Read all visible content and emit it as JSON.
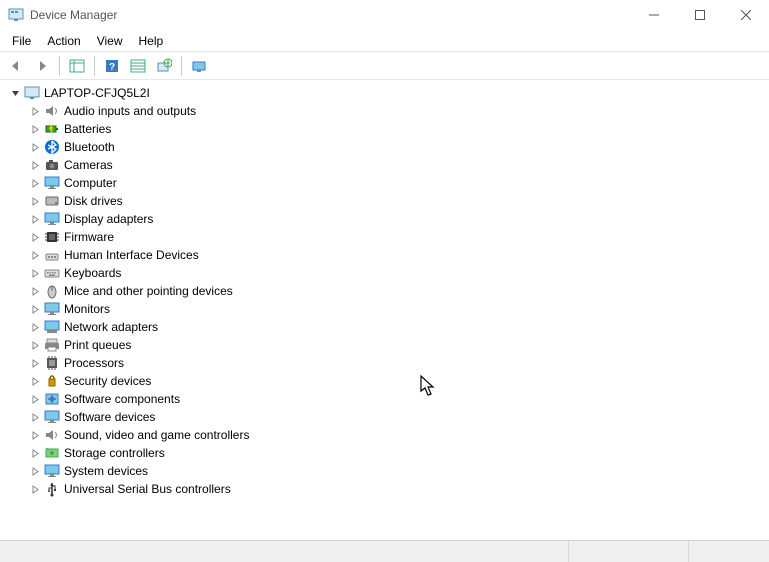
{
  "window": {
    "title": "Device Manager"
  },
  "menu": {
    "file": "File",
    "action": "Action",
    "view": "View",
    "help": "Help"
  },
  "tree": {
    "root": {
      "label": "LAPTOP-CFJQ5L2I",
      "expanded": true
    },
    "categories": [
      {
        "label": "Audio inputs and outputs",
        "icon": "speaker"
      },
      {
        "label": "Batteries",
        "icon": "battery"
      },
      {
        "label": "Bluetooth",
        "icon": "bluetooth"
      },
      {
        "label": "Cameras",
        "icon": "camera"
      },
      {
        "label": "Computer",
        "icon": "monitor"
      },
      {
        "label": "Disk drives",
        "icon": "disk"
      },
      {
        "label": "Display adapters",
        "icon": "monitor"
      },
      {
        "label": "Firmware",
        "icon": "chip"
      },
      {
        "label": "Human Interface Devices",
        "icon": "hid"
      },
      {
        "label": "Keyboards",
        "icon": "keyboard"
      },
      {
        "label": "Mice and other pointing devices",
        "icon": "mouse"
      },
      {
        "label": "Monitors",
        "icon": "monitor"
      },
      {
        "label": "Network adapters",
        "icon": "network"
      },
      {
        "label": "Print queues",
        "icon": "printer"
      },
      {
        "label": "Processors",
        "icon": "cpu"
      },
      {
        "label": "Security devices",
        "icon": "security"
      },
      {
        "label": "Software components",
        "icon": "software"
      },
      {
        "label": "Software devices",
        "icon": "monitor"
      },
      {
        "label": "Sound, video and game controllers",
        "icon": "speaker"
      },
      {
        "label": "Storage controllers",
        "icon": "storage"
      },
      {
        "label": "System devices",
        "icon": "monitor"
      },
      {
        "label": "Universal Serial Bus controllers",
        "icon": "usb"
      }
    ]
  }
}
